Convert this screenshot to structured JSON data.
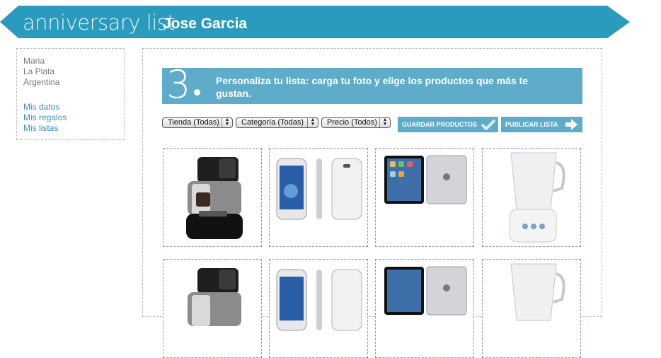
{
  "header": {
    "brand": "anniversary list",
    "user_name": "Jose Garcia"
  },
  "sidebar": {
    "info": [
      "Maria",
      "La Plata",
      "Argentina"
    ],
    "links": [
      "Mis datos",
      "Mis regalos",
      "Mis listas"
    ]
  },
  "step": {
    "number": "3",
    "text": "Personaliza tu lista: carga tu foto y elige los productos que más te gustan."
  },
  "filters": {
    "tienda": "Tienda (Todas)",
    "categoria": "Categoría (Todas)",
    "precio": "Precio (Todos)"
  },
  "actions": {
    "save_label": "GUARDAR PRODUCTOS",
    "publish_label": "PUBLICAR LISTA"
  },
  "colors": {
    "brand_teal": "#2b9bbd",
    "step_blue": "#5eacca",
    "link_blue": "#3d8fb5"
  },
  "products": [
    {
      "icon": "coffee-machine-icon"
    },
    {
      "icon": "smartphone-icon"
    },
    {
      "icon": "tablet-icon"
    },
    {
      "icon": "blender-icon"
    },
    {
      "icon": "coffee-machine-icon"
    },
    {
      "icon": "smartphone-icon"
    },
    {
      "icon": "tablet-icon"
    },
    {
      "icon": "blender-icon"
    }
  ]
}
